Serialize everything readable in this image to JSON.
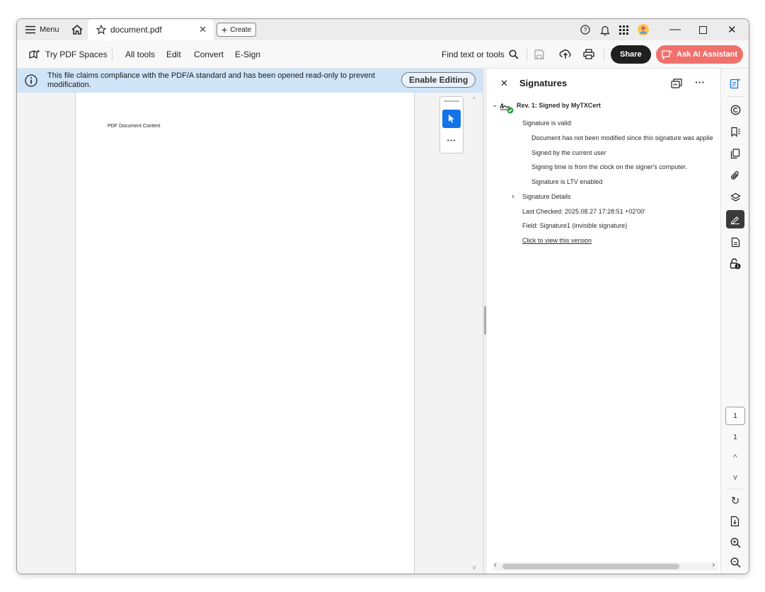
{
  "titlebar": {
    "menu_label": "Menu",
    "tab_title": "document.pdf",
    "create_label": "Create"
  },
  "toolbar": {
    "try_spaces": "Try PDF Spaces",
    "items": [
      "All tools",
      "Edit",
      "Convert",
      "E-Sign"
    ],
    "find_text": "Find text or tools",
    "share_label": "Share",
    "ask_ai_label": "Ask AI Assistant"
  },
  "banner": {
    "message": "This file claims compliance with the PDF/A standard and has been opened read-only to prevent modification.",
    "enable_label": "Enable Editing"
  },
  "document": {
    "content_text": "PDF Document Content"
  },
  "signatures": {
    "title": "Signatures",
    "revision": "Rev. 1: Signed by MyTXCert",
    "valid_text": "Signature is valid:",
    "details": [
      "Document has not been modified since this signature was applie",
      "Signed by the current user",
      "Signing time is from the clock on the signer's computer.",
      "Signature is LTV enabled"
    ],
    "details_label": "Signature Details",
    "last_checked": "Last Checked: 2025.08.27 17:28:51 +02'00'",
    "field": "Field: Signature1 (invisible signature)",
    "view_link": "Click to view this version"
  },
  "pager": {
    "current_page": "1",
    "total_pages": "1"
  },
  "colors": {
    "accent_blue": "#1473e6",
    "share_bg": "#1f1f1f",
    "ai_bg": "#f0716b",
    "banner_bg": "#cfe4f7",
    "valid_green": "#2d9d3a"
  }
}
